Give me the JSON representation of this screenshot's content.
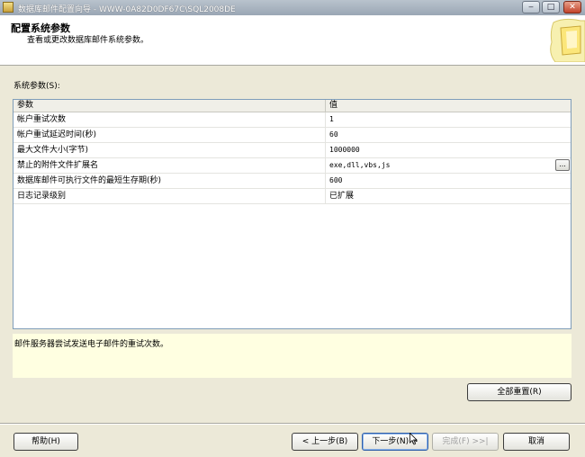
{
  "window": {
    "title": "数据库邮件配置向导 - WWW-0A82D0DF67C\\SQL2008DE",
    "controls": [
      "minimize-icon",
      "maximize-icon",
      "close-icon"
    ]
  },
  "header": {
    "title": "配置系统参数",
    "subtitle": "查看或更改数据库邮件系统参数。"
  },
  "params_label": "系统参数(S):",
  "grid": {
    "columns": [
      "参数",
      "值"
    ],
    "rows": [
      {
        "name": "帐户重试次数",
        "value": "1"
      },
      {
        "name": "帐户重试延迟时间(秒)",
        "value": "60"
      },
      {
        "name": "最大文件大小(字节)",
        "value": "1000000"
      },
      {
        "name": "禁止的附件文件扩展名",
        "value": "exe,dll,vbs,js"
      },
      {
        "name": "数据库邮件可执行文件的最短生存期(秒)",
        "value": "600"
      },
      {
        "name": "日志记录级别",
        "value": "已扩展"
      }
    ],
    "ellipsis_label": "..."
  },
  "description": "邮件服务器尝试发送电子邮件的重试次数。",
  "buttons": {
    "reset": "全部重置(R)",
    "help": "帮助(H)",
    "back": "< 上一步(B)",
    "next": "下一步(N) >",
    "finish": "完成(F) >>|",
    "cancel": "取消"
  }
}
